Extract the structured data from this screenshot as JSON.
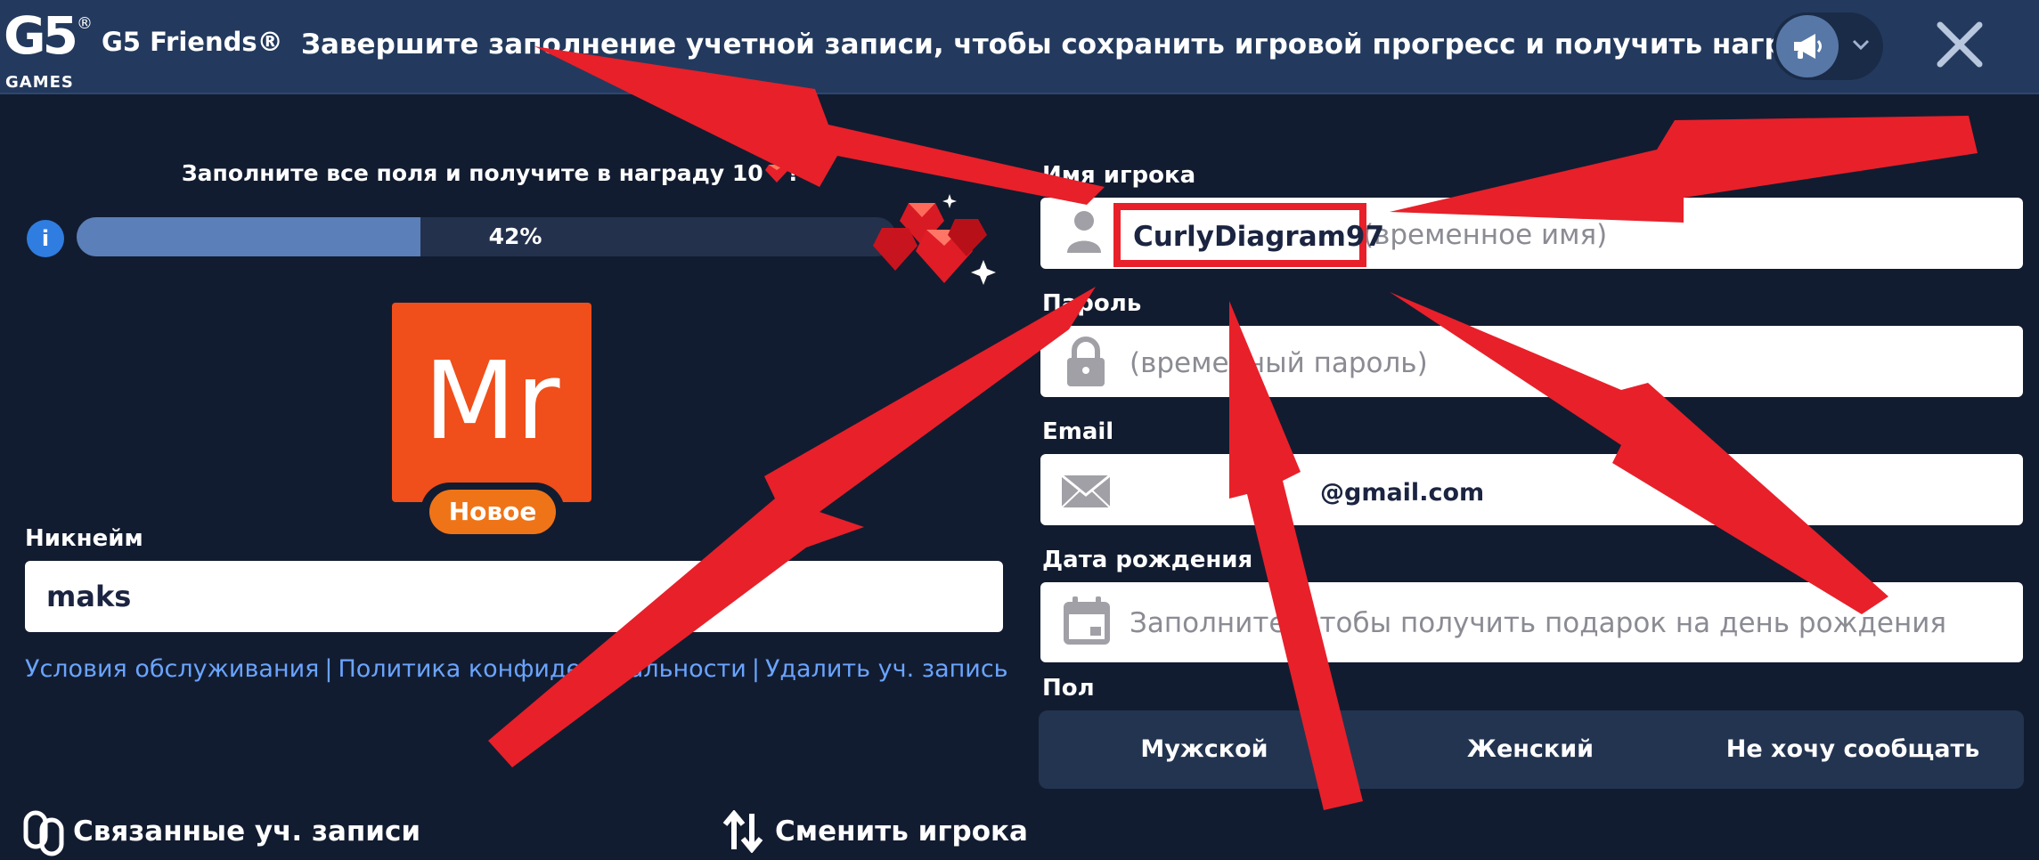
{
  "header": {
    "logo_mark": "G5",
    "logo_registered": "®",
    "logo_sub": "GAMES",
    "app_title": "G5 Friends®",
    "message": "Завершите заполнение учетной записи, чтобы сохранить игровой прогресс и получить награду.",
    "icons": [
      "megaphone-icon",
      "chevron-down-icon",
      "close-icon"
    ]
  },
  "reward": {
    "text": "Заполните все поля и получите в награду 10",
    "suffix": "!",
    "progress_percent": 42,
    "progress_label": "42%",
    "info_glyph": "i"
  },
  "profile": {
    "avatar_initials": "Mr",
    "avatar_color": "#f04e1a",
    "badge": "Новое",
    "badge_color": "#ef7418"
  },
  "nickname": {
    "label": "Никнейм",
    "value": "maks"
  },
  "links": {
    "terms": "Условия обслуживания",
    "privacy": "Политика конфиденциальности",
    "delete": "Удалить уч. запись",
    "separator": "|"
  },
  "footer": {
    "linked_accounts": "Связанные уч. записи",
    "switch_player": "Сменить игрока"
  },
  "form": {
    "player": {
      "label": "Имя игрока",
      "value": "CurlyDiagram97",
      "placeholder": "(временное имя)"
    },
    "password": {
      "label": "Пароль",
      "placeholder": "(временный пароль)"
    },
    "email": {
      "label": "Email",
      "value": "@gmail.com"
    },
    "birthday": {
      "label": "Дата рождения",
      "placeholder": "Заполните, чтобы получить подарок на день рождения"
    },
    "gender": {
      "label": "Пол",
      "options": [
        "Мужской",
        "Женский",
        "Не хочу сообщать"
      ]
    }
  },
  "colors": {
    "background": "#121c30",
    "header": "#233a5e",
    "accent_blue": "#5b7fb8",
    "link": "#6aa4ff",
    "annotation_red": "#e8202a"
  }
}
